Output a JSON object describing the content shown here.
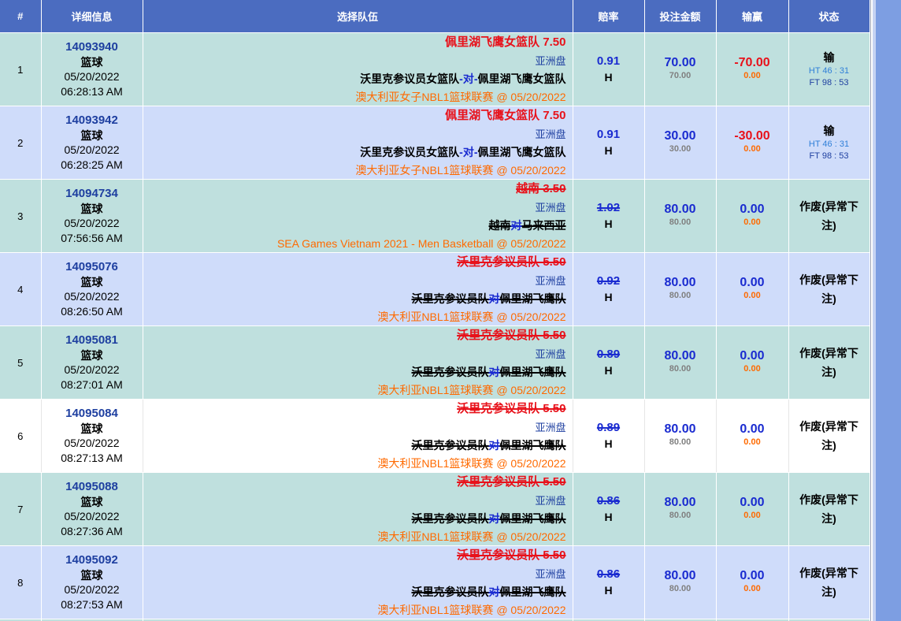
{
  "headers": {
    "num": "#",
    "info": "详细信息",
    "selection": "选择队伍",
    "odds": "赔率",
    "stake": "投注金额",
    "winloss": "输赢",
    "status": "状态"
  },
  "rows": [
    {
      "num": "1",
      "id": "14093940",
      "sport": "篮球",
      "date": "05/20/2022",
      "time": "06:28:13 AM",
      "sel": "佩里湖飞鹰女篮队 7.50",
      "market": "亚洲盘",
      "home": "沃里克参议员女篮队",
      "vs": "-对-",
      "away": "佩里湖飞鹰女篮队",
      "league": "澳大利亚女子NBL1篮球联赛",
      "at": "@",
      "league_date": "05/20/2022",
      "odds": "0.91",
      "side": "H",
      "stake": "70.00",
      "stake_sub": "70.00",
      "win": "-70.00",
      "win_sub": "0.00",
      "result": "输",
      "ht": "HT 46 : 31",
      "ft": "FT 98 : 53"
    },
    {
      "num": "2",
      "id": "14093942",
      "sport": "篮球",
      "date": "05/20/2022",
      "time": "06:28:25 AM",
      "sel": "佩里湖飞鹰女篮队 7.50",
      "market": "亚洲盘",
      "home": "沃里克参议员女篮队",
      "vs": "-对-",
      "away": "佩里湖飞鹰女篮队",
      "league": "澳大利亚女子NBL1篮球联赛",
      "at": "@",
      "league_date": "05/20/2022",
      "odds": "0.91",
      "side": "H",
      "stake": "30.00",
      "stake_sub": "30.00",
      "win": "-30.00",
      "win_sub": "0.00",
      "result": "输",
      "ht": "HT 46 : 31",
      "ft": "FT 98 : 53"
    },
    {
      "num": "3",
      "id": "14094734",
      "sport": "篮球",
      "date": "05/20/2022",
      "time": "07:56:56 AM",
      "sel": "越南  3.50",
      "market": "亚洲盘",
      "home": "越南",
      "vs": "对",
      "away": "马来西亚",
      "league": "SEA Games Vietnam 2021 - Men Basketball",
      "at": "@",
      "league_date": "05/20/2022",
      "odds": "1.02",
      "side": "H",
      "stake": "80.00",
      "stake_sub": "80.00",
      "win": "0.00",
      "win_sub": "0.00",
      "status": "作废(异常下注)"
    },
    {
      "num": "4",
      "id": "14095076",
      "sport": "篮球",
      "date": "05/20/2022",
      "time": "08:26:50 AM",
      "sel": "沃里克参议员队  5.50",
      "market": "亚洲盘",
      "home": "沃里克参议员队",
      "vs": "对",
      "away": "佩里湖飞鹰队",
      "league": "澳大利亚NBL1篮球联赛",
      "at": "@",
      "league_date": "05/20/2022",
      "odds": "0.92",
      "side": "H",
      "stake": "80.00",
      "stake_sub": "80.00",
      "win": "0.00",
      "win_sub": "0.00",
      "status": "作废(异常下注)"
    },
    {
      "num": "5",
      "id": "14095081",
      "sport": "篮球",
      "date": "05/20/2022",
      "time": "08:27:01 AM",
      "sel": "沃里克参议员队  5.50",
      "market": "亚洲盘",
      "home": "沃里克参议员队",
      "vs": "对",
      "away": "佩里湖飞鹰队",
      "league": "澳大利亚NBL1篮球联赛",
      "at": "@",
      "league_date": "05/20/2022",
      "odds": "0.89",
      "side": "H",
      "stake": "80.00",
      "stake_sub": "80.00",
      "win": "0.00",
      "win_sub": "0.00",
      "status": "作废(异常下注)"
    },
    {
      "num": "6",
      "id": "14095084",
      "sport": "篮球",
      "date": "05/20/2022",
      "time": "08:27:13 AM",
      "sel": "沃里克参议员队  5.50",
      "market": "亚洲盘",
      "home": "沃里克参议员队",
      "vs": "对",
      "away": "佩里湖飞鹰队",
      "league": "澳大利亚NBL1篮球联赛",
      "at": "@",
      "league_date": "05/20/2022",
      "odds": "0.89",
      "side": "H",
      "stake": "80.00",
      "stake_sub": "80.00",
      "win": "0.00",
      "win_sub": "0.00",
      "status": "作废(异常下注)"
    },
    {
      "num": "7",
      "id": "14095088",
      "sport": "篮球",
      "date": "05/20/2022",
      "time": "08:27:36 AM",
      "sel": "沃里克参议员队  5.50",
      "market": "亚洲盘",
      "home": "沃里克参议员队",
      "vs": "对",
      "away": "佩里湖飞鹰队",
      "league": "澳大利亚NBL1篮球联赛",
      "at": "@",
      "league_date": "05/20/2022",
      "odds": "0.86",
      "side": "H",
      "stake": "80.00",
      "stake_sub": "80.00",
      "win": "0.00",
      "win_sub": "0.00",
      "status": "作废(异常下注)"
    },
    {
      "num": "8",
      "id": "14095092",
      "sport": "篮球",
      "date": "05/20/2022",
      "time": "08:27:53 AM",
      "sel": "沃里克参议员队  5.50",
      "market": "亚洲盘",
      "home": "沃里克参议员队",
      "vs": "对",
      "away": "佩里湖飞鹰队",
      "league": "澳大利亚NBL1篮球联赛",
      "at": "@",
      "league_date": "05/20/2022",
      "odds": "0.86",
      "side": "H",
      "stake": "80.00",
      "stake_sub": "80.00",
      "win": "0.00",
      "win_sub": "0.00",
      "status": "作废(异常下注)"
    }
  ],
  "colors": {
    "header_bg": "#4b6cc0",
    "row_teal": "#bfe0de",
    "row_blue": "#cfdcfa",
    "red": "#e8111a",
    "blue": "#1a2bd0",
    "orange": "#ff6a00"
  }
}
